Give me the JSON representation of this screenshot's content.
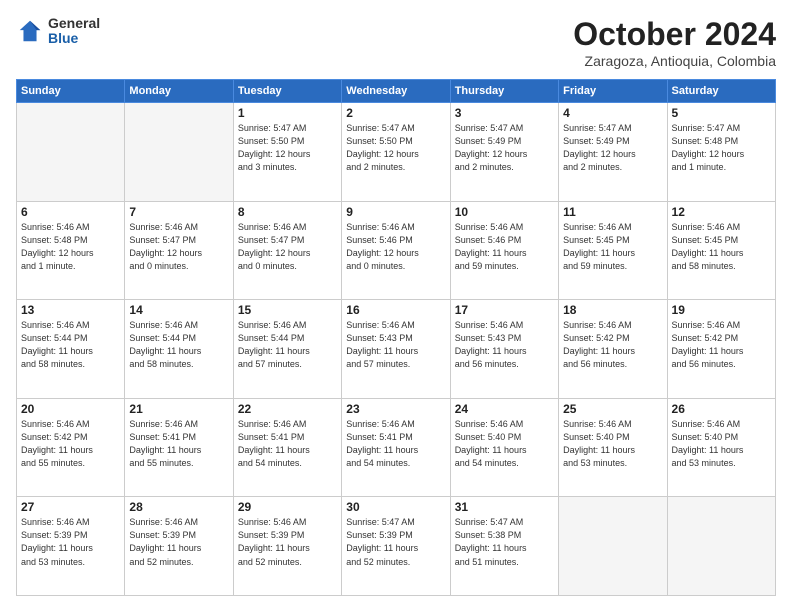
{
  "logo": {
    "general": "General",
    "blue": "Blue"
  },
  "header": {
    "month": "October 2024",
    "location": "Zaragoza, Antioquia, Colombia"
  },
  "weekdays": [
    "Sunday",
    "Monday",
    "Tuesday",
    "Wednesday",
    "Thursday",
    "Friday",
    "Saturday"
  ],
  "weeks": [
    [
      {
        "day": "",
        "info": ""
      },
      {
        "day": "",
        "info": ""
      },
      {
        "day": "1",
        "info": "Sunrise: 5:47 AM\nSunset: 5:50 PM\nDaylight: 12 hours\nand 3 minutes."
      },
      {
        "day": "2",
        "info": "Sunrise: 5:47 AM\nSunset: 5:50 PM\nDaylight: 12 hours\nand 2 minutes."
      },
      {
        "day": "3",
        "info": "Sunrise: 5:47 AM\nSunset: 5:49 PM\nDaylight: 12 hours\nand 2 minutes."
      },
      {
        "day": "4",
        "info": "Sunrise: 5:47 AM\nSunset: 5:49 PM\nDaylight: 12 hours\nand 2 minutes."
      },
      {
        "day": "5",
        "info": "Sunrise: 5:47 AM\nSunset: 5:48 PM\nDaylight: 12 hours\nand 1 minute."
      }
    ],
    [
      {
        "day": "6",
        "info": "Sunrise: 5:46 AM\nSunset: 5:48 PM\nDaylight: 12 hours\nand 1 minute."
      },
      {
        "day": "7",
        "info": "Sunrise: 5:46 AM\nSunset: 5:47 PM\nDaylight: 12 hours\nand 0 minutes."
      },
      {
        "day": "8",
        "info": "Sunrise: 5:46 AM\nSunset: 5:47 PM\nDaylight: 12 hours\nand 0 minutes."
      },
      {
        "day": "9",
        "info": "Sunrise: 5:46 AM\nSunset: 5:46 PM\nDaylight: 12 hours\nand 0 minutes."
      },
      {
        "day": "10",
        "info": "Sunrise: 5:46 AM\nSunset: 5:46 PM\nDaylight: 11 hours\nand 59 minutes."
      },
      {
        "day": "11",
        "info": "Sunrise: 5:46 AM\nSunset: 5:45 PM\nDaylight: 11 hours\nand 59 minutes."
      },
      {
        "day": "12",
        "info": "Sunrise: 5:46 AM\nSunset: 5:45 PM\nDaylight: 11 hours\nand 58 minutes."
      }
    ],
    [
      {
        "day": "13",
        "info": "Sunrise: 5:46 AM\nSunset: 5:44 PM\nDaylight: 11 hours\nand 58 minutes."
      },
      {
        "day": "14",
        "info": "Sunrise: 5:46 AM\nSunset: 5:44 PM\nDaylight: 11 hours\nand 58 minutes."
      },
      {
        "day": "15",
        "info": "Sunrise: 5:46 AM\nSunset: 5:44 PM\nDaylight: 11 hours\nand 57 minutes."
      },
      {
        "day": "16",
        "info": "Sunrise: 5:46 AM\nSunset: 5:43 PM\nDaylight: 11 hours\nand 57 minutes."
      },
      {
        "day": "17",
        "info": "Sunrise: 5:46 AM\nSunset: 5:43 PM\nDaylight: 11 hours\nand 56 minutes."
      },
      {
        "day": "18",
        "info": "Sunrise: 5:46 AM\nSunset: 5:42 PM\nDaylight: 11 hours\nand 56 minutes."
      },
      {
        "day": "19",
        "info": "Sunrise: 5:46 AM\nSunset: 5:42 PM\nDaylight: 11 hours\nand 56 minutes."
      }
    ],
    [
      {
        "day": "20",
        "info": "Sunrise: 5:46 AM\nSunset: 5:42 PM\nDaylight: 11 hours\nand 55 minutes."
      },
      {
        "day": "21",
        "info": "Sunrise: 5:46 AM\nSunset: 5:41 PM\nDaylight: 11 hours\nand 55 minutes."
      },
      {
        "day": "22",
        "info": "Sunrise: 5:46 AM\nSunset: 5:41 PM\nDaylight: 11 hours\nand 54 minutes."
      },
      {
        "day": "23",
        "info": "Sunrise: 5:46 AM\nSunset: 5:41 PM\nDaylight: 11 hours\nand 54 minutes."
      },
      {
        "day": "24",
        "info": "Sunrise: 5:46 AM\nSunset: 5:40 PM\nDaylight: 11 hours\nand 54 minutes."
      },
      {
        "day": "25",
        "info": "Sunrise: 5:46 AM\nSunset: 5:40 PM\nDaylight: 11 hours\nand 53 minutes."
      },
      {
        "day": "26",
        "info": "Sunrise: 5:46 AM\nSunset: 5:40 PM\nDaylight: 11 hours\nand 53 minutes."
      }
    ],
    [
      {
        "day": "27",
        "info": "Sunrise: 5:46 AM\nSunset: 5:39 PM\nDaylight: 11 hours\nand 53 minutes."
      },
      {
        "day": "28",
        "info": "Sunrise: 5:46 AM\nSunset: 5:39 PM\nDaylight: 11 hours\nand 52 minutes."
      },
      {
        "day": "29",
        "info": "Sunrise: 5:46 AM\nSunset: 5:39 PM\nDaylight: 11 hours\nand 52 minutes."
      },
      {
        "day": "30",
        "info": "Sunrise: 5:47 AM\nSunset: 5:39 PM\nDaylight: 11 hours\nand 52 minutes."
      },
      {
        "day": "31",
        "info": "Sunrise: 5:47 AM\nSunset: 5:38 PM\nDaylight: 11 hours\nand 51 minutes."
      },
      {
        "day": "",
        "info": ""
      },
      {
        "day": "",
        "info": ""
      }
    ]
  ]
}
